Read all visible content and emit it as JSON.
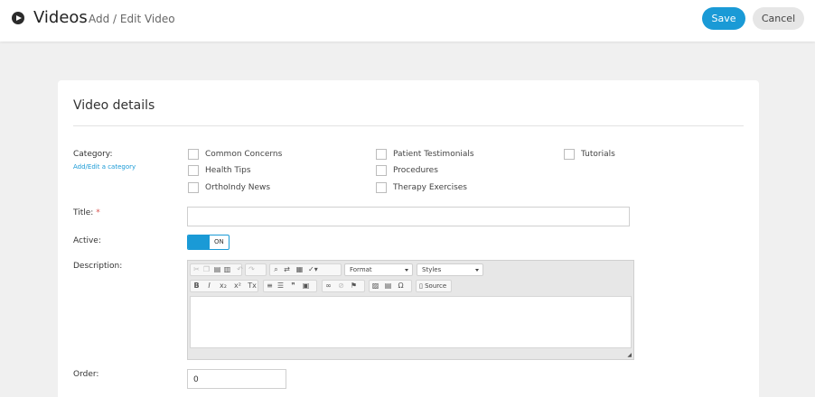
{
  "header": {
    "title": "Videos",
    "subtitle": "Add / Edit Video",
    "save_label": "Save",
    "cancel_label": "Cancel",
    "accent": "#1a9ad6"
  },
  "card": {
    "heading": "Video details",
    "category_label": "Category:",
    "category_link": "Add/Edit a category",
    "categories": [
      "Common Concerns",
      "Health Tips",
      "OrthoIndy News",
      "Patient Testimonials",
      "Procedures",
      "Therapy Exercises",
      "Tutorials"
    ],
    "title_label": "Title:",
    "title_required": "*",
    "title_value": "",
    "active_label": "Active:",
    "active_state": "ON",
    "description_label": "Description:",
    "editor": {
      "format_label": "Format",
      "styles_label": "Styles",
      "source_label": "Source",
      "bold": "B",
      "italic": "I",
      "subscript": "x₂",
      "superscript": "x²",
      "clear_format": "Tx",
      "quote": "❞",
      "special_char": "Ω"
    },
    "order_label": "Order:",
    "order_value": "0"
  }
}
